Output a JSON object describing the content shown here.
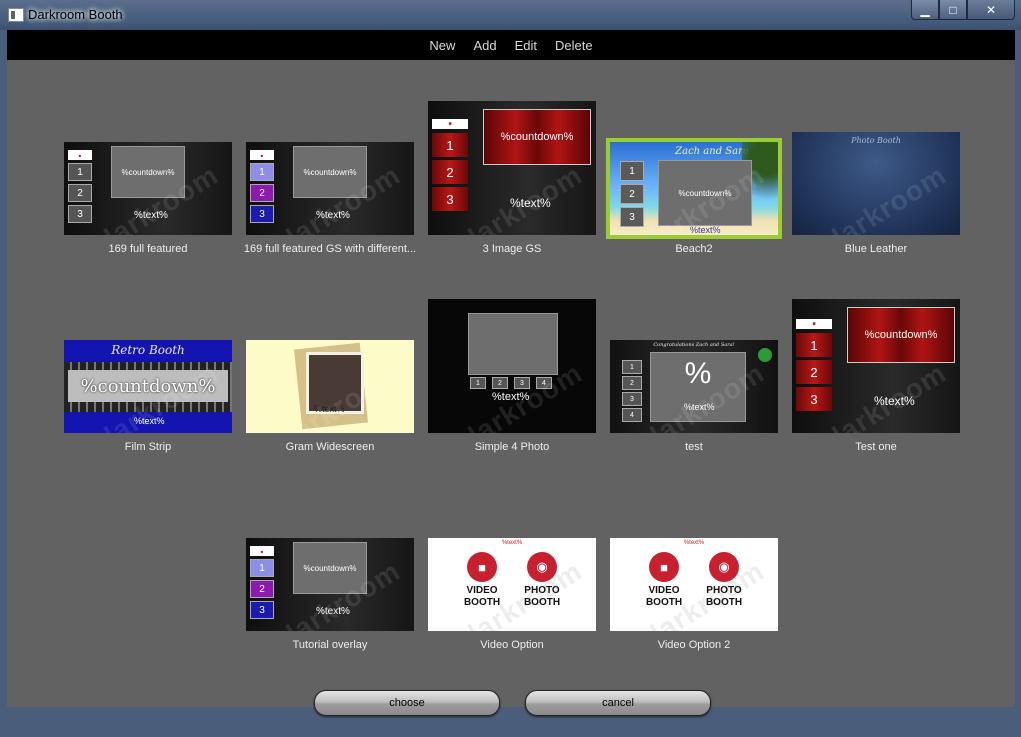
{
  "window": {
    "title": "Darkroom Booth",
    "min_glyph": "▁",
    "max_glyph": "□",
    "close_glyph": "✕"
  },
  "menu": [
    {
      "label": "New"
    },
    {
      "label": "Add"
    },
    {
      "label": "Edit"
    },
    {
      "label": "Delete"
    }
  ],
  "watermark": "darkroom",
  "placeholders": {
    "countdown": "%countdown%",
    "text": "%text%",
    "percent": "%"
  },
  "tiles": [
    {
      "label": "169 full featured"
    },
    {
      "label": "169 full featured GS with different..."
    },
    {
      "label": "3 Image GS"
    },
    {
      "label": "Beach2",
      "selected": true,
      "caption": "Zach and Sara"
    },
    {
      "label": "Blue Leather",
      "caption": "Photo Booth"
    },
    {
      "label": "Film Strip",
      "caption": "Retro Booth"
    },
    {
      "label": "Gram Widescreen"
    },
    {
      "label": "Simple 4 Photo"
    },
    {
      "label": "test",
      "caption": "Congratulations Zach and Sara!"
    },
    {
      "label": "Test one"
    },
    {
      "label": "Tutorial overlay"
    },
    {
      "label": "Video Option",
      "video": "VIDEO BOOTH",
      "photo": "PHOTO BOOTH"
    },
    {
      "label": "Video Option 2",
      "video": "VIDEO BOOTH",
      "photo": "PHOTO BOOTH"
    }
  ],
  "buttons": {
    "choose": "choose",
    "cancel": "cancel"
  },
  "colors": {
    "selection": "#9acd32",
    "client_bg": "#626262",
    "menubar_bg": "#000000"
  }
}
